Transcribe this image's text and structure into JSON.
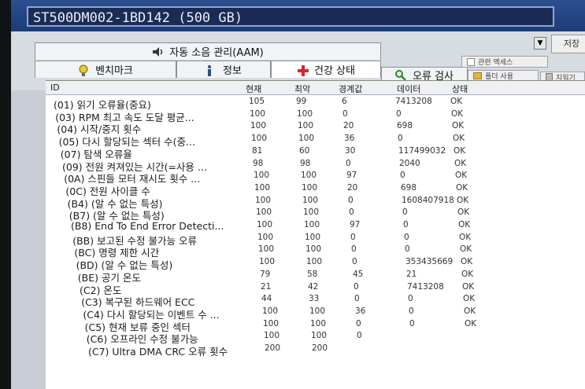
{
  "drive": {
    "name": "ST500DM002-1BD142 (500 GB)"
  },
  "side_button": "저장",
  "tabs": {
    "aam": "자동 소음 관리(AAM)",
    "benchmark": "벤치마크",
    "info": "정보",
    "health": "건강 상태",
    "error_scan": "오류 검사",
    "small1": "관련 액세스",
    "small2": "폴더 사용",
    "small3": "지워기"
  },
  "columns": [
    "ID",
    "현재",
    "최악",
    "경계값",
    "데이터",
    "상태"
  ],
  "rows": [
    {
      "id": "(01) 읽기 오류율(중요)",
      "cur": "105",
      "worst": "99",
      "thr": "6",
      "data": "7413208",
      "status": "OK"
    },
    {
      "id": "(03) RPM 최고 속도 도달 평균...",
      "cur": "100",
      "worst": "100",
      "thr": "0",
      "data": "0",
      "status": "OK"
    },
    {
      "id": "(04) 시작/중지 횟수",
      "cur": "100",
      "worst": "100",
      "thr": "20",
      "data": "698",
      "status": "OK"
    },
    {
      "id": "(05) 다시 할당되는 섹터 수(중...",
      "cur": "100",
      "worst": "100",
      "thr": "36",
      "data": "0",
      "status": "OK"
    },
    {
      "id": "(07) 탐색 오류율",
      "cur": "81",
      "worst": "60",
      "thr": "30",
      "data": "117499032",
      "status": "OK"
    },
    {
      "id": "(09) 전원 켜져있는 시간(=사용 ...",
      "cur": "98",
      "worst": "98",
      "thr": "0",
      "data": "2040",
      "status": "OK"
    },
    {
      "id": "(0A) 스핀들 모터 재시도 횟수 ...",
      "cur": "100",
      "worst": "100",
      "thr": "97",
      "data": "0",
      "status": "OK"
    },
    {
      "id": "(0C) 전원 사이클 수",
      "cur": "100",
      "worst": "100",
      "thr": "20",
      "data": "698",
      "status": "OK"
    },
    {
      "id": "(B4) (알 수 없는 특성)",
      "cur": "100",
      "worst": "100",
      "thr": "0",
      "data": "1608407918",
      "status": "OK"
    },
    {
      "id": "(B7) (알 수 없는 특성)",
      "cur": "100",
      "worst": "100",
      "thr": "0",
      "data": "0",
      "status": "OK"
    },
    {
      "id": "(B8) End To End Error Detecti...",
      "cur": "100",
      "worst": "100",
      "thr": "97",
      "data": "0",
      "status": "OK"
    },
    {
      "id": "(BB) 보고된 수정 불가능 오류",
      "cur": "100",
      "worst": "100",
      "thr": "0",
      "data": "0",
      "status": "OK"
    },
    {
      "id": "(BC) 명령 제한 시간",
      "cur": "100",
      "worst": "100",
      "thr": "0",
      "data": "0",
      "status": "OK"
    },
    {
      "id": "(BD) (알 수 없는 특성)",
      "cur": "100",
      "worst": "100",
      "thr": "0",
      "data": "353435669",
      "status": "OK"
    },
    {
      "id": "(BE) 공기 온도",
      "cur": "79",
      "worst": "58",
      "thr": "45",
      "data": "21",
      "status": "OK"
    },
    {
      "id": "(C2) 온도",
      "cur": "21",
      "worst": "42",
      "thr": "0",
      "data": "7413208",
      "status": "OK"
    },
    {
      "id": "(C3) 복구된 하드웨어 ECC",
      "cur": "44",
      "worst": "33",
      "thr": "0",
      "data": "0",
      "status": "OK"
    },
    {
      "id": "(C4) 다시 할당되는 이벤트 수 ...",
      "cur": "100",
      "worst": "100",
      "thr": "36",
      "data": "0",
      "status": "OK"
    },
    {
      "id": "(C5) 현재 보류 중인 섹터",
      "cur": "100",
      "worst": "100",
      "thr": "0",
      "data": "0",
      "status": "OK"
    },
    {
      "id": "(C6) 오프라인 수정 불가능",
      "cur": "100",
      "worst": "100",
      "thr": "0",
      "data": "",
      "status": ""
    },
    {
      "id": "(C7) Ultra DMA CRC 오류 횟수",
      "cur": "200",
      "worst": "200",
      "thr": "",
      "data": "",
      "status": ""
    }
  ]
}
